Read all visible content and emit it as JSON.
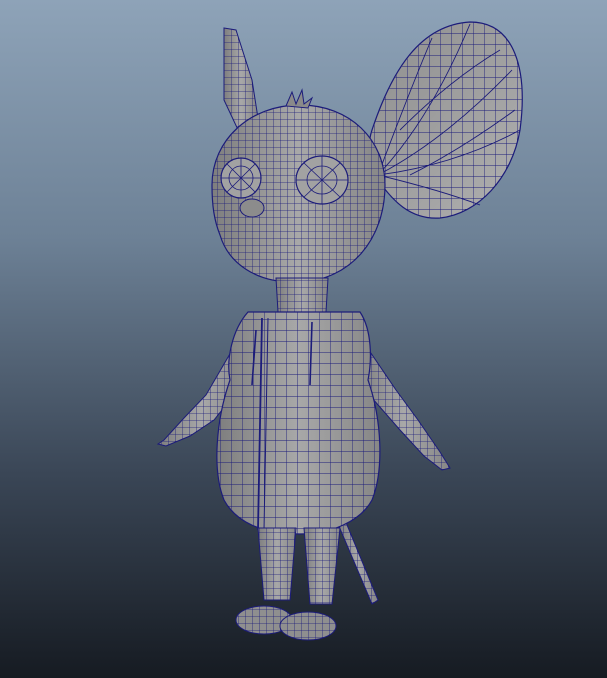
{
  "viewport": {
    "background_top": "#8ea3b8",
    "background_bottom": "#161b22"
  },
  "model": {
    "surface_color": "#9c9c9c",
    "wire_color": "#1c1c7a",
    "icon": "mouse-character-wireframe"
  }
}
